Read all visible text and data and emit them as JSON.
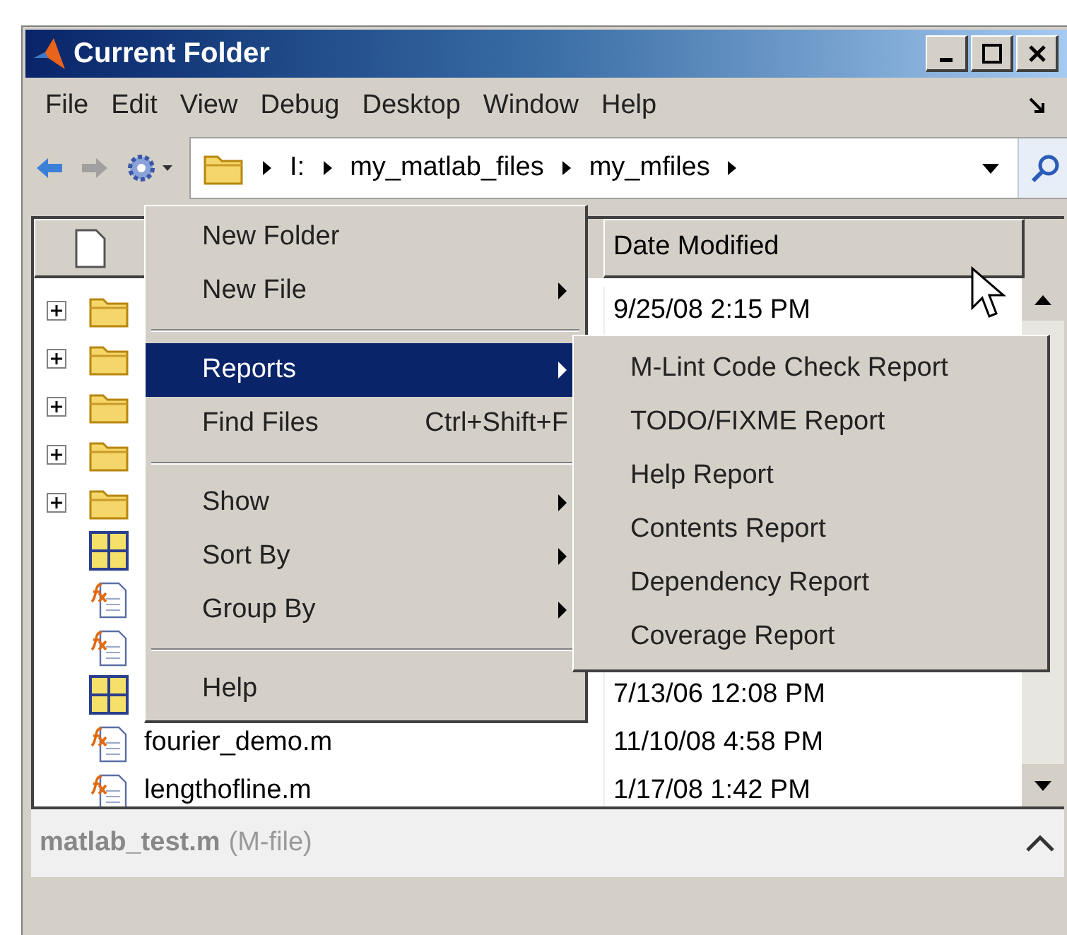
{
  "window": {
    "title": "Current Folder"
  },
  "menu_bar": [
    "File",
    "Edit",
    "View",
    "Debug",
    "Desktop",
    "Window",
    "Help"
  ],
  "toolbar": {
    "back_enabled": true,
    "forward_enabled": false,
    "path": [
      "I:",
      "my_matlab_files",
      "my_mfiles"
    ]
  },
  "table": {
    "columns": [
      {
        "kind": "icon"
      },
      {
        "kind": "text",
        "label": "Date Modified"
      }
    ],
    "rows": [
      {
        "kind": "folder",
        "date": "9/25/08 2:15 PM"
      },
      {
        "kind": "folder"
      },
      {
        "kind": "folder"
      },
      {
        "kind": "folder"
      },
      {
        "kind": "folder"
      },
      {
        "kind": "figure"
      },
      {
        "kind": "mfile"
      },
      {
        "kind": "mfile"
      },
      {
        "kind": "figure",
        "date": "7/13/06 12:08 PM"
      },
      {
        "kind": "mfile",
        "name": "fourier_demo.m",
        "date": "11/10/08 4:58 PM"
      },
      {
        "kind": "mfile",
        "name": "lengthofline.m",
        "date": "1/17/08 1:42 PM"
      }
    ]
  },
  "details": {
    "name": "matlab_test.m",
    "type": "(M-file)"
  },
  "context_menu": [
    {
      "kind": "item",
      "label": "New Folder",
      "submenu": false,
      "selected": false
    },
    {
      "kind": "item",
      "label": "New File",
      "submenu": true,
      "selected": false
    },
    {
      "kind": "separator"
    },
    {
      "kind": "item",
      "label": "Reports",
      "submenu": true,
      "selected": true
    },
    {
      "kind": "item",
      "label": "Find Files",
      "shortcut": "Ctrl+Shift+F",
      "submenu": false,
      "selected": false
    },
    {
      "kind": "separator"
    },
    {
      "kind": "item",
      "label": "Show",
      "submenu": true,
      "selected": false
    },
    {
      "kind": "item",
      "label": "Sort By",
      "submenu": true,
      "selected": false
    },
    {
      "kind": "item",
      "label": "Group By",
      "submenu": true,
      "selected": false
    },
    {
      "kind": "separator"
    },
    {
      "kind": "item",
      "label": "Help",
      "submenu": false,
      "selected": false
    }
  ],
  "submenu": [
    "M-Lint Code Check Report",
    "TODO/FIXME Report",
    "Help Report",
    "Contents Report",
    "Dependency Report",
    "Coverage Report"
  ]
}
